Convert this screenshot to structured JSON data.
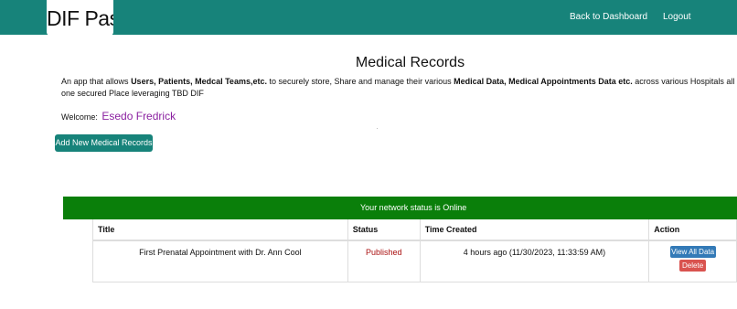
{
  "header": {
    "logo": "DIF Pass",
    "nav": {
      "back_to_dashboard": "Back to Dashboard",
      "logout": "Logout"
    }
  },
  "main": {
    "title": "Medical Records",
    "intro": {
      "p1": "An app that allows ",
      "b1": "Users, Patients, Medcal Teams,etc.",
      "p2": " to securely store, Share and manage their various ",
      "b2": "Medical Data, Medical Appointments Data etc.",
      "p3": " across various Hospitals all in one secured Place leveraging TBD DIF"
    },
    "welcome_label": "Welcome:",
    "user_name": "Esedo Fredrick",
    "add_button": "Add New Medical Records",
    "network_status": "Your network status is Online"
  },
  "table": {
    "headers": {
      "title": "Title",
      "status": "Status",
      "time": "Time Created",
      "action": "Action"
    },
    "rows": [
      {
        "title": "First Prenatal Appointment with Dr. Ann Cool",
        "status": "Published",
        "time": "4 hours ago (11/30/2023, 11:33:59 AM)",
        "view": "View All Data",
        "delete": "Delete"
      }
    ]
  },
  "colors": {
    "brand": "#17837a",
    "status_online": "#0a7f0a",
    "welcome_name": "#8a1fa0",
    "published": "#aa1111",
    "view_button": "#337ab7",
    "delete_button": "#d9534f"
  }
}
